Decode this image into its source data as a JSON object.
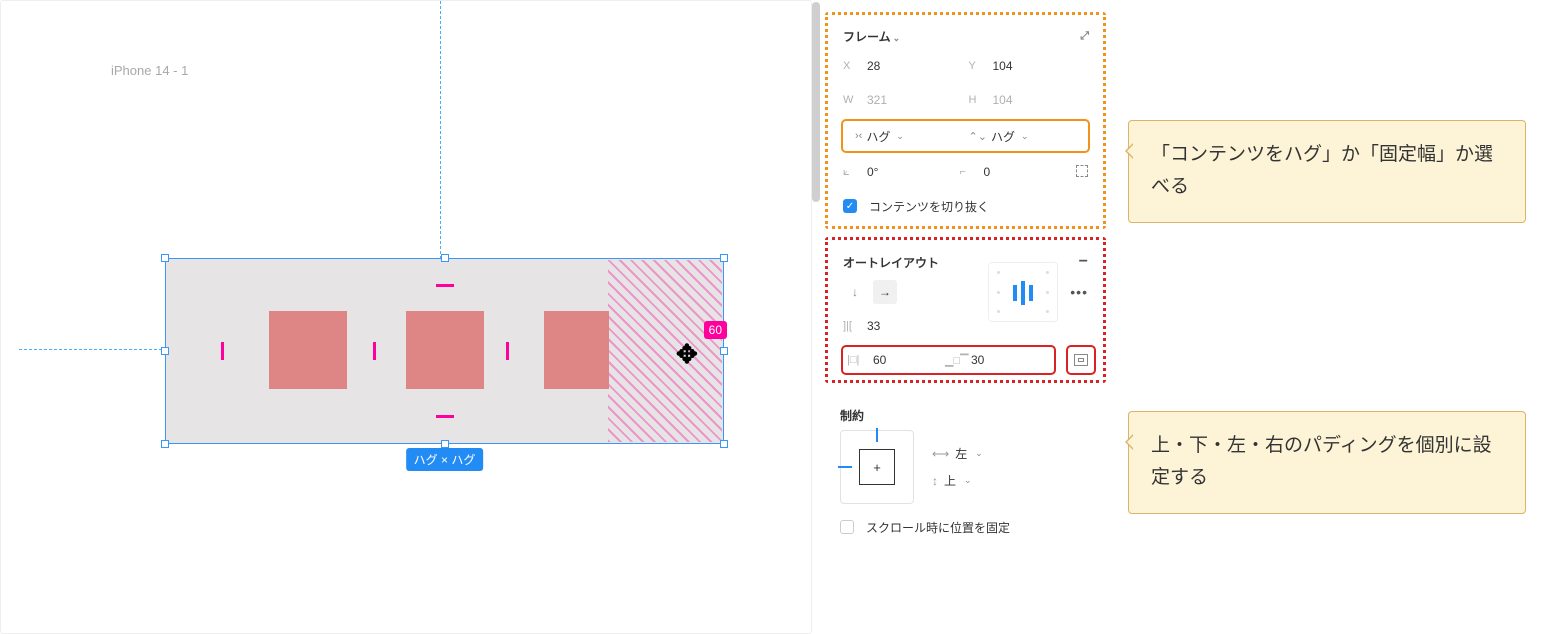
{
  "canvas": {
    "artboard_title": "iPhone 14 - 1",
    "padding_measure": "60",
    "size_badge": "ハグ × ハグ"
  },
  "panel": {
    "frame": {
      "title": "フレーム",
      "x_label": "X",
      "x": "28",
      "y_label": "Y",
      "y": "104",
      "w_label": "W",
      "w": "321",
      "h_label": "H",
      "h": "104",
      "resize_w": "ハグ",
      "resize_h": "ハグ",
      "rotation": "0°",
      "corner": "0",
      "clip_label": "コンテンツを切り抜く"
    },
    "autolayout": {
      "title": "オートレイアウト",
      "spacing": "33",
      "pad_h": "60",
      "pad_v": "30"
    },
    "constraints": {
      "title": "制約",
      "h": "左",
      "v": "上",
      "fix_scroll_label": "スクロール時に位置を固定"
    }
  },
  "callouts": {
    "c1": "「コンテンツをハグ」か「固定幅」か選べる",
    "c2": "上・下・左・右のパディングを個別に設定する"
  }
}
